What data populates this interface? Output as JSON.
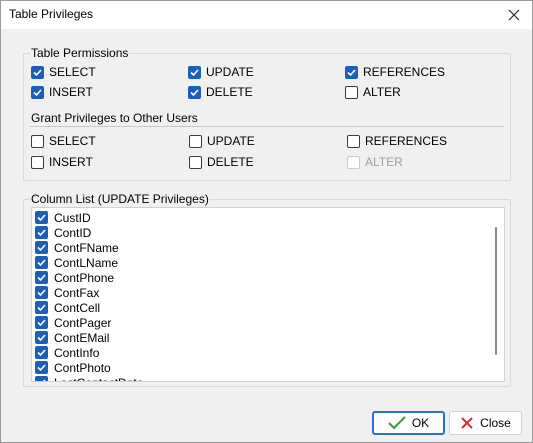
{
  "window": {
    "title": "Table Privileges",
    "close_icon": "close-icon"
  },
  "table_permissions": {
    "legend": "Table Permissions",
    "items": [
      {
        "label": "SELECT",
        "checked": true
      },
      {
        "label": "UPDATE",
        "checked": true
      },
      {
        "label": "REFERENCES",
        "checked": true
      },
      {
        "label": "INSERT",
        "checked": true
      },
      {
        "label": "DELETE",
        "checked": true
      },
      {
        "label": "ALTER",
        "checked": false
      }
    ]
  },
  "grant_privileges": {
    "legend": "Grant Privileges to Other Users",
    "items": [
      {
        "label": "SELECT",
        "checked": false,
        "enabled": true
      },
      {
        "label": "UPDATE",
        "checked": false,
        "enabled": true
      },
      {
        "label": "REFERENCES",
        "checked": false,
        "enabled": true
      },
      {
        "label": "INSERT",
        "checked": false,
        "enabled": true
      },
      {
        "label": "DELETE",
        "checked": false,
        "enabled": true
      },
      {
        "label": "ALTER",
        "checked": false,
        "enabled": false
      }
    ]
  },
  "column_list": {
    "legend": "Column List (UPDATE Privileges)",
    "items": [
      {
        "label": "CustID",
        "checked": true
      },
      {
        "label": "ContID",
        "checked": true
      },
      {
        "label": "ContFName",
        "checked": true
      },
      {
        "label": "ContLName",
        "checked": true
      },
      {
        "label": "ContPhone",
        "checked": true
      },
      {
        "label": "ContFax",
        "checked": true
      },
      {
        "label": "ContCell",
        "checked": true
      },
      {
        "label": "ContPager",
        "checked": true
      },
      {
        "label": "ContEMail",
        "checked": true
      },
      {
        "label": "ContInfo",
        "checked": true
      },
      {
        "label": "ContPhoto",
        "checked": true
      },
      {
        "label": "LastContactDate",
        "checked": true
      }
    ]
  },
  "buttons": {
    "ok": "OK",
    "close": "Close"
  },
  "colors": {
    "accent": "#1d5fb8",
    "ok_check": "#3a9a3a",
    "close_x": "#d03030"
  }
}
